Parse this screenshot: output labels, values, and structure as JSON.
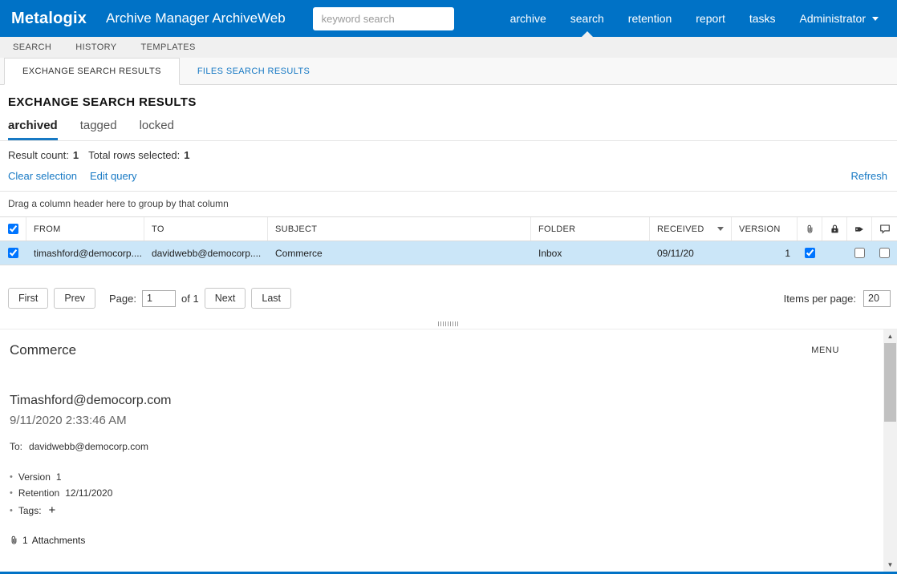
{
  "header": {
    "brand": "Metalogix",
    "app_title": "Archive Manager ArchiveWeb",
    "search_placeholder": "keyword search",
    "nav": [
      {
        "label": "archive"
      },
      {
        "label": "search"
      },
      {
        "label": "retention"
      },
      {
        "label": "report"
      },
      {
        "label": "tasks"
      },
      {
        "label": "Administrator"
      }
    ]
  },
  "subnav": [
    {
      "label": "SEARCH"
    },
    {
      "label": "HISTORY"
    },
    {
      "label": "TEMPLATES"
    }
  ],
  "tabs": [
    {
      "label": "EXCHANGE SEARCH RESULTS"
    },
    {
      "label": "FILES SEARCH RESULTS"
    }
  ],
  "results": {
    "title": "EXCHANGE SEARCH RESULTS",
    "filters": [
      {
        "label": "archived"
      },
      {
        "label": "tagged"
      },
      {
        "label": "locked"
      }
    ],
    "result_count_label": "Result count:",
    "result_count": "1",
    "rows_selected_label": "Total rows selected:",
    "rows_selected": "1",
    "clear_selection_label": "Clear selection",
    "edit_query_label": "Edit query",
    "refresh_label": "Refresh",
    "group_hint": "Drag a column header here to group by that column",
    "table": {
      "select_all_checked": true,
      "columns": {
        "from": "FROM",
        "to": "TO",
        "subject": "SUBJECT",
        "folder": "FOLDER",
        "received": "RECEIVED",
        "version": "VERSION"
      },
      "row": {
        "selected": true,
        "from": "timashford@democorp....",
        "to": "davidwebb@democorp....",
        "subject": "Commerce",
        "folder": "Inbox",
        "received": "09/11/20",
        "version": "1",
        "has_attachment": true,
        "tagged": false,
        "has_comment": false
      }
    },
    "pagination": {
      "first_label": "First",
      "prev_label": "Prev",
      "page_label": "Page:",
      "page_value": "1",
      "page_of": "of 1",
      "next_label": "Next",
      "last_label": "Last",
      "items_per_page_label": "Items per page:",
      "items_per_page_value": "20"
    }
  },
  "preview": {
    "subject": "Commerce",
    "menu_label": "MENU",
    "from": "Timashford@democorp.com",
    "date": "9/11/2020 2:33:46 AM",
    "to_label": "To:",
    "to": "davidwebb@democorp.com",
    "version_label": "Version",
    "version": "1",
    "retention_label": "Retention",
    "retention": "12/11/2020",
    "tags_label": "Tags:",
    "add_tag_label": "+",
    "attachment_count": "1",
    "attachments_label": "Attachments"
  },
  "icons": {
    "bullet": "•",
    "scroll_up": "▲",
    "scroll_down": "▼"
  },
  "colors": {
    "brand_blue": "#0072c6",
    "link_blue": "#1779c4",
    "selected_row": "#cbe6f8"
  }
}
